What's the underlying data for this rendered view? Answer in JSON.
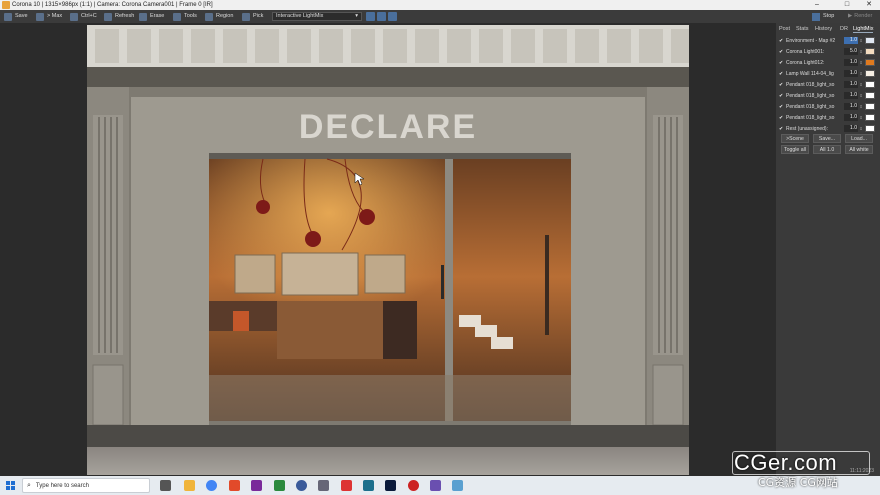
{
  "window": {
    "title": "Corona 10 | 1315×986px (1:1) | Camera: Corona Camera001 | Frame 0 [IR]",
    "minimize": "–",
    "maximize": "□",
    "close": "✕"
  },
  "toolbar": {
    "save": "Save",
    "max": "> Max",
    "ctrlc": "Ctrl+C",
    "refresh": "Refresh",
    "erase": "Erase",
    "tools": "Tools",
    "region": "Region",
    "pick": "Pick",
    "channel": "Interactive LightMix",
    "stop": "Stop",
    "render": "Render"
  },
  "scene": {
    "sign_text": "DECLARE"
  },
  "panel": {
    "tabs": [
      "Post",
      "Stats",
      "History",
      "DR",
      "LightMix"
    ],
    "active_tab": "LightMix",
    "lightmix": [
      {
        "name": "Environment - Map #2",
        "value": "1.0",
        "color": "#dfe6f0",
        "selected": true
      },
      {
        "name": "Corona Light001:",
        "value": "5.0",
        "color": "#f3dcc0",
        "selected": false
      },
      {
        "name": "Corona Light012:",
        "value": "1.0",
        "color": "#e07a1e",
        "selected": false
      },
      {
        "name": "Lamp Wall 114-04_lig",
        "value": "1.0",
        "color": "#f6efe4",
        "selected": false
      },
      {
        "name": "Pendant 018_light_so",
        "value": "1.0",
        "color": "#ffffff",
        "selected": false
      },
      {
        "name": "Pendant 018_light_so",
        "value": "1.0",
        "color": "#ffffff",
        "selected": false
      },
      {
        "name": "Pendant 018_light_so",
        "value": "1.0",
        "color": "#ffffff",
        "selected": false
      },
      {
        "name": "Pendant 018_light_so",
        "value": "1.0",
        "color": "#ffffff",
        "selected": false
      },
      {
        "name": "Rest (unassigned):",
        "value": "1.0",
        "color": "#ffffff",
        "selected": false
      }
    ],
    "btn_to_scene": ">Scene",
    "btn_save": "Save...",
    "btn_load": "Load...",
    "btn_toggle_all": "Toggle all",
    "btn_all_1": "All 1.0",
    "btn_all_white": "All white",
    "status_time": "11:11:2023"
  },
  "taskbar": {
    "search_placeholder": "Type here to search"
  },
  "watermark": {
    "main": "CGer.com",
    "sub": "CG资源 CG网站"
  },
  "colors": {
    "accent_blue": "#3d6fb0",
    "ui_dark": "#3a3a3a",
    "facade": "#8f8a80",
    "interior_warm": "#b36b34"
  }
}
